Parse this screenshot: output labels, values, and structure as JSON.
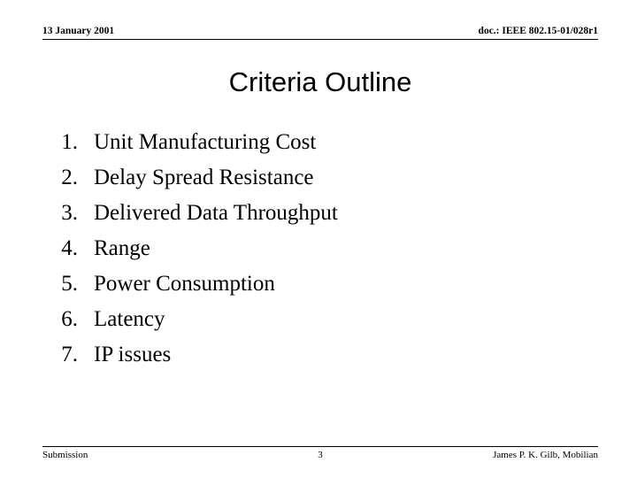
{
  "header": {
    "date": "13 January 2001",
    "doc_id": "doc.: IEEE 802.15-01/028r1"
  },
  "title": "Criteria Outline",
  "list": [
    {
      "number": "1.",
      "text": "Unit Manufacturing Cost"
    },
    {
      "number": "2.",
      "text": "Delay Spread Resistance"
    },
    {
      "number": "3.",
      "text": "Delivered Data Throughput"
    },
    {
      "number": "4.",
      "text": "Range"
    },
    {
      "number": "5.",
      "text": "Power Consumption"
    },
    {
      "number": "6.",
      "text": "Latency"
    },
    {
      "number": "7.",
      "text": "IP issues"
    }
  ],
  "footer": {
    "left": "Submission",
    "page": "3",
    "right": "James P. K. Gilb, Mobilian"
  }
}
